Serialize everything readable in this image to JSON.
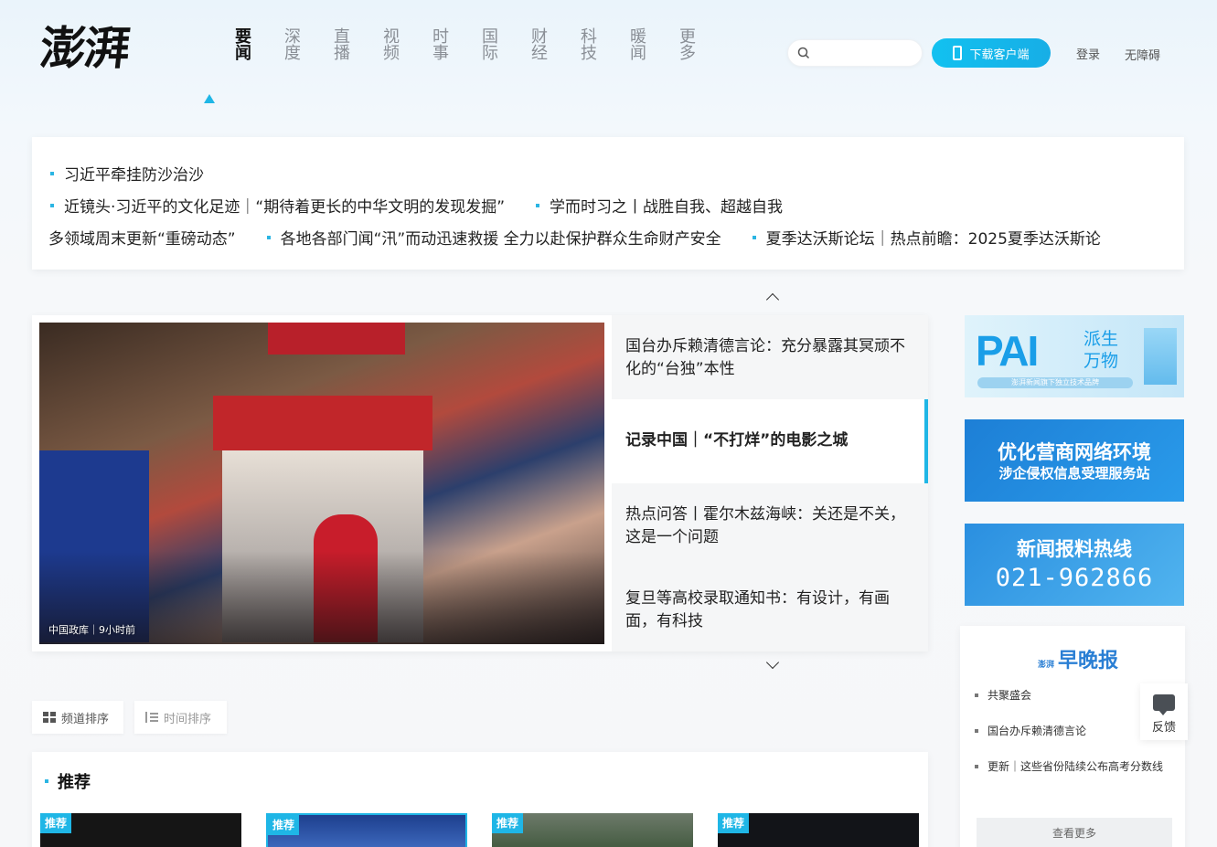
{
  "brand": {
    "logo_text": "澎湃"
  },
  "nav": {
    "items": [
      "要闻",
      "深度",
      "直播",
      "视频",
      "时事",
      "国际",
      "财经",
      "科技",
      "暖闻",
      "更多"
    ],
    "active_index": 0
  },
  "header": {
    "search_placeholder": "",
    "download_label": "下载客户端",
    "login_label": "登录",
    "accessible_label": "无障碍"
  },
  "hot_topics": {
    "row1": [
      "习近平牵挂防沙治沙"
    ],
    "row2": [
      "近镜头·习近平的文化足迹｜“期待着更长的中华文明的发现发掘”",
      "学而时习之丨战胜自我、超越自我"
    ],
    "row3": [
      "多领域周末更新“重磅动态”",
      "各地各部门闻“汛”而动迅速救援 全力以赴保护群众生命财产安全",
      "夏季达沃斯论坛｜热点前瞻：2025夏季达沃斯论"
    ]
  },
  "feature": {
    "image_caption": "中国政库｜9小时前",
    "stories": [
      "国台办斥赖清德言论：充分暴露其冥顽不化的“台独”本性",
      "记录中国｜“不打烊”的电影之城",
      "热点问答丨霍尔木兹海峡：关还是不关，这是一个问题",
      "复旦等高校录取通知书：有设计，有画面，有科技"
    ],
    "active_index": 1
  },
  "ads": {
    "ad1": {
      "big": "PAI",
      "small": "派生万物",
      "sub": "澎湃新闻旗下独立技术品牌"
    },
    "ad2": {
      "line1": "优化营商网络环境",
      "line2": "涉企侵权信息受理服务站"
    },
    "ad3": {
      "line1": "新闻报料热线",
      "line2": "021-962866"
    }
  },
  "evening_paper": {
    "logo_small": "澎湃",
    "logo": "早晚报",
    "items": [
      "共聚盛会",
      "国台办斥赖清德言论",
      "更新｜这些省份陆续公布高考分数线"
    ],
    "more_label": "查看更多"
  },
  "feedback": {
    "label": "反馈"
  },
  "sort_tabs": {
    "channel": "频道排序",
    "time": "时间排序"
  },
  "recommend": {
    "title": "推荐",
    "badge": "推荐"
  },
  "colors": {
    "accent": "#1fb6e6",
    "text": "#222222"
  }
}
